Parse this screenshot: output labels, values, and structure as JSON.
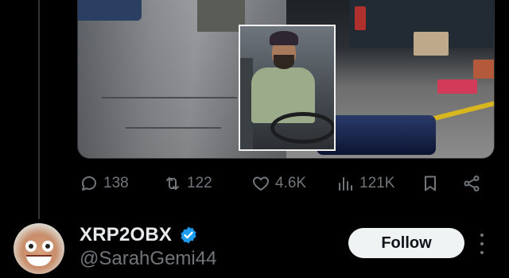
{
  "tweet": {
    "media": {
      "description_icon": "video-thumbnail"
    },
    "actions": {
      "replies": "138",
      "reposts": "122",
      "likes": "4.6K",
      "views": "121K"
    }
  },
  "suggested_user": {
    "display_name": "XRP2OBX",
    "handle": "@SarahGemi44",
    "follow_label": "Follow",
    "verified_color": "#1d9bf0"
  },
  "colors": {
    "background": "#000000",
    "muted": "#71767b",
    "text": "#e7e9ea",
    "follow_bg": "#eff3f4"
  }
}
